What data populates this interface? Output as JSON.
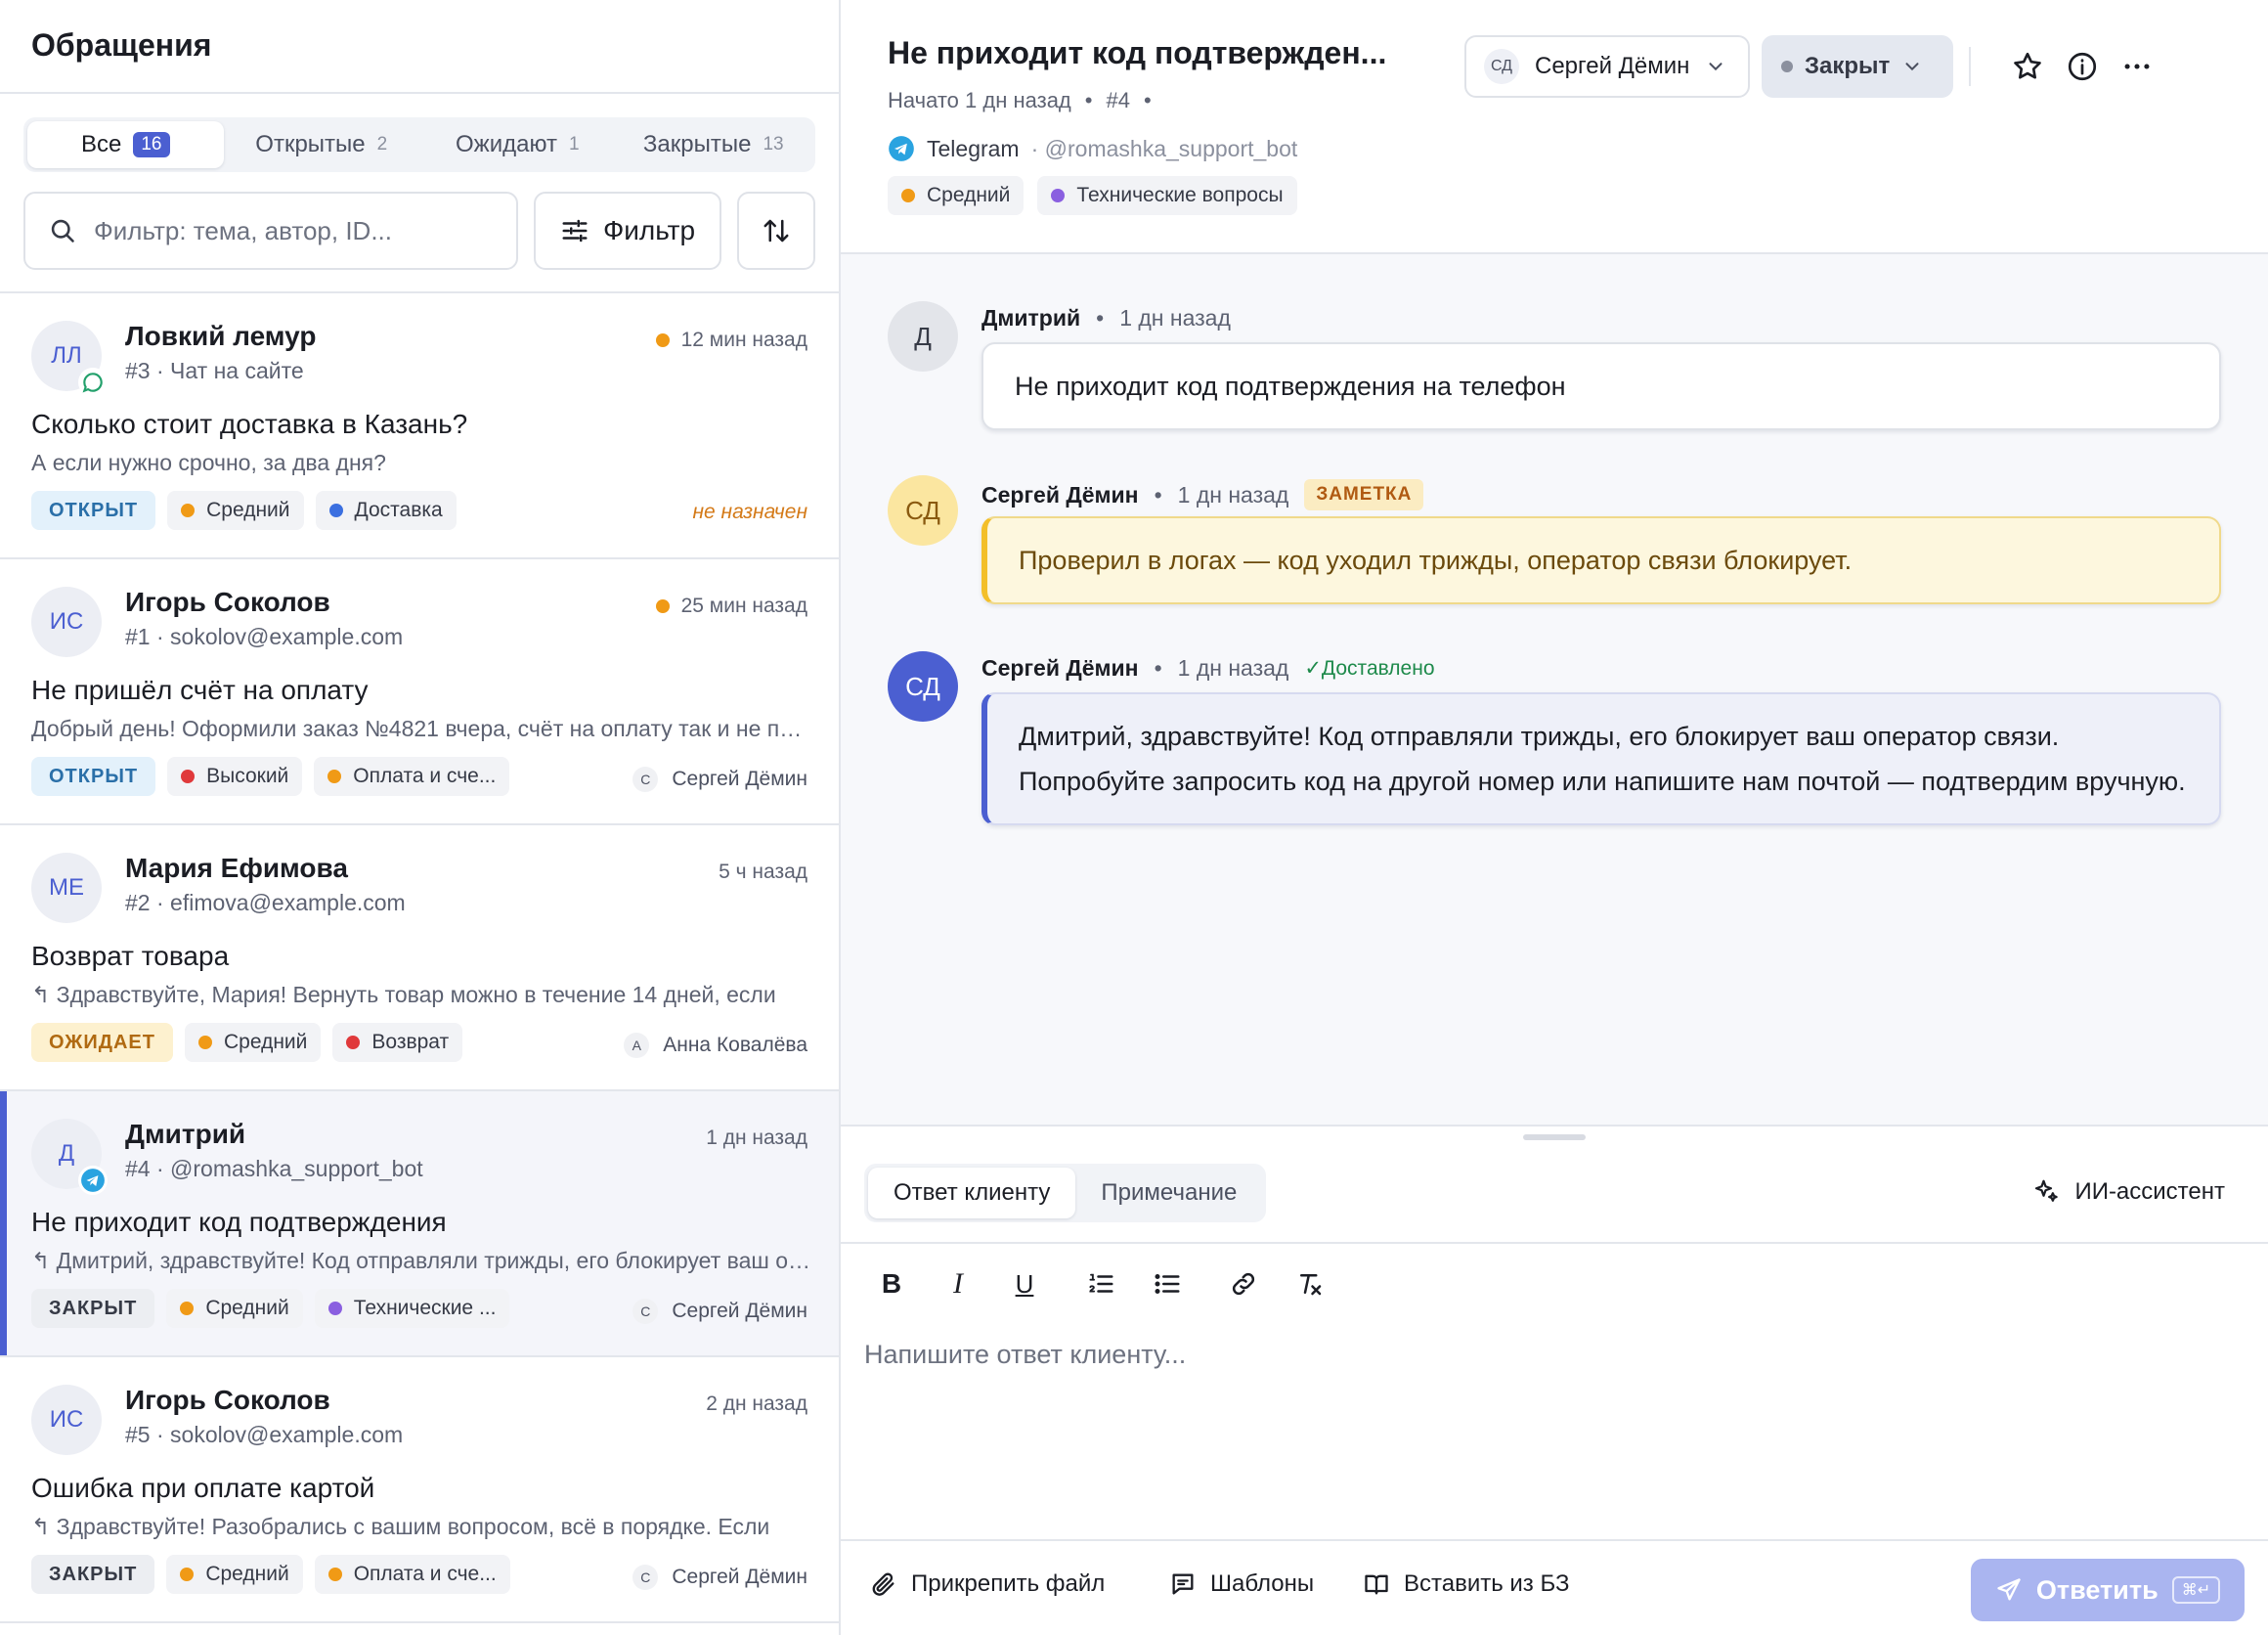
{
  "sidebar": {
    "title": "Обращения",
    "tabs": [
      {
        "label": "Все",
        "count": "16"
      },
      {
        "label": "Открытые",
        "count": "2"
      },
      {
        "label": "Ожидают",
        "count": "1"
      },
      {
        "label": "Закрытые",
        "count": "13"
      }
    ],
    "search_placeholder": "Фильтр: тема, автор, ID...",
    "filter_label": "Фильтр",
    "unassigned_label": "не назначен",
    "tickets": [
      {
        "initials": "ЛЛ",
        "name": "Ловкий лемур",
        "id": "#3",
        "source": "Чат на сайте",
        "time": "12 мин назад",
        "subject": "Сколько стоит доставка в Казань?",
        "preview": "А если нужно срочно, за два дня?",
        "status": "ОТКРЫТ",
        "priority": "Средний",
        "category": "Доставка",
        "assignee": ""
      },
      {
        "initials": "ИС",
        "name": "Игорь Соколов",
        "id": "#1",
        "source": "sokolov@example.com",
        "time": "25 мин назад",
        "subject": "Не пришёл счёт на оплату",
        "preview": "Добрый день! Оформили заказ №4821 вчера, счёт на оплату так и не пришёл",
        "status": "ОТКРЫТ",
        "priority": "Высокий",
        "category": "Оплата и сче...",
        "assignee_initial": "С",
        "assignee": "Сергей Дёмин"
      },
      {
        "initials": "МЕ",
        "name": "Мария Ефимова",
        "id": "#2",
        "source": "efimova@example.com",
        "time": "5 ч назад",
        "subject": "Возврат товара",
        "preview": "Здравствуйте, Мария! Вернуть товар можно в течение 14 дней, если",
        "status": "ОЖИДАЕТ",
        "priority": "Средний",
        "category": "Возврат",
        "assignee_initial": "А",
        "assignee": "Анна Ковалёва"
      },
      {
        "initials": "Д",
        "name": "Дмитрий",
        "id": "#4",
        "source": "@romashka_support_bot",
        "time": "1 дн назад",
        "subject": "Не приходит код подтверждения",
        "preview": "Дмитрий, здравствуйте! Код отправляли трижды, его блокирует ваш оператор",
        "status": "ЗАКРЫТ",
        "priority": "Средний",
        "category": "Технические ...",
        "assignee_initial": "С",
        "assignee": "Сергей Дёмин"
      },
      {
        "initials": "ИС",
        "name": "Игорь Соколов",
        "id": "#5",
        "source": "sokolov@example.com",
        "time": "2 дн назад",
        "subject": "Ошибка при оплате картой",
        "preview": "Здравствуйте! Разобрались с вашим вопросом, всё в порядке. Если",
        "status": "ЗАКРЫТ",
        "priority": "Средний",
        "category": "Оплата и сче...",
        "assignee_initial": "С",
        "assignee": "Сергей Дёмин"
      }
    ]
  },
  "conversation": {
    "title": "Не приходит код подтвержден...",
    "started": "Начато 1 дн назад",
    "ticket_id": "#4",
    "channel": "Telegram",
    "handle": "· @romashka_support_bot",
    "priority": "Средний",
    "category": "Технические вопросы",
    "assignee_initials": "СД",
    "assignee": "Сергей Дёмин",
    "status": "Закрыт",
    "messages": [
      {
        "initials": "Д",
        "author": "Дмитрий",
        "time": "1 дн назад",
        "text": "Не приходит код подтверждения на телефон"
      },
      {
        "initials": "СД",
        "author": "Сергей Дёмин",
        "time": "1 дн назад",
        "badge": "ЗАМЕТКА",
        "text": "Проверил в логах — код уходил трижды, оператор связи блокирует."
      },
      {
        "initials": "СД",
        "author": "Сергей Дёмин",
        "time": "1 дн назад",
        "delivered": "✓Доставлено",
        "text": "Дмитрий, здравствуйте! Код отправляли трижды, его блокирует ваш оператор связи. Попробуйте запросить код на другой номер или напишите нам почтой — подтвердим вручную."
      }
    ]
  },
  "composer": {
    "tab_reply": "Ответ клиенту",
    "tab_note": "Примечание",
    "ai_label": "ИИ-ассистент",
    "placeholder": "Напишите ответ клиенту...",
    "attach": "Прикрепить файл",
    "templates": "Шаблоны",
    "kb": "Вставить из БЗ",
    "send": "Ответить",
    "send_hint": "⌘↵"
  },
  "colors": {
    "accent": "#4b5fd1",
    "priority_medium": "#f09a16",
    "priority_high": "#e0393b",
    "category_delivery": "#3b6fe0",
    "category_payment": "#f09a16",
    "category_return": "#e0393b",
    "category_tech": "#8a5fe0"
  }
}
